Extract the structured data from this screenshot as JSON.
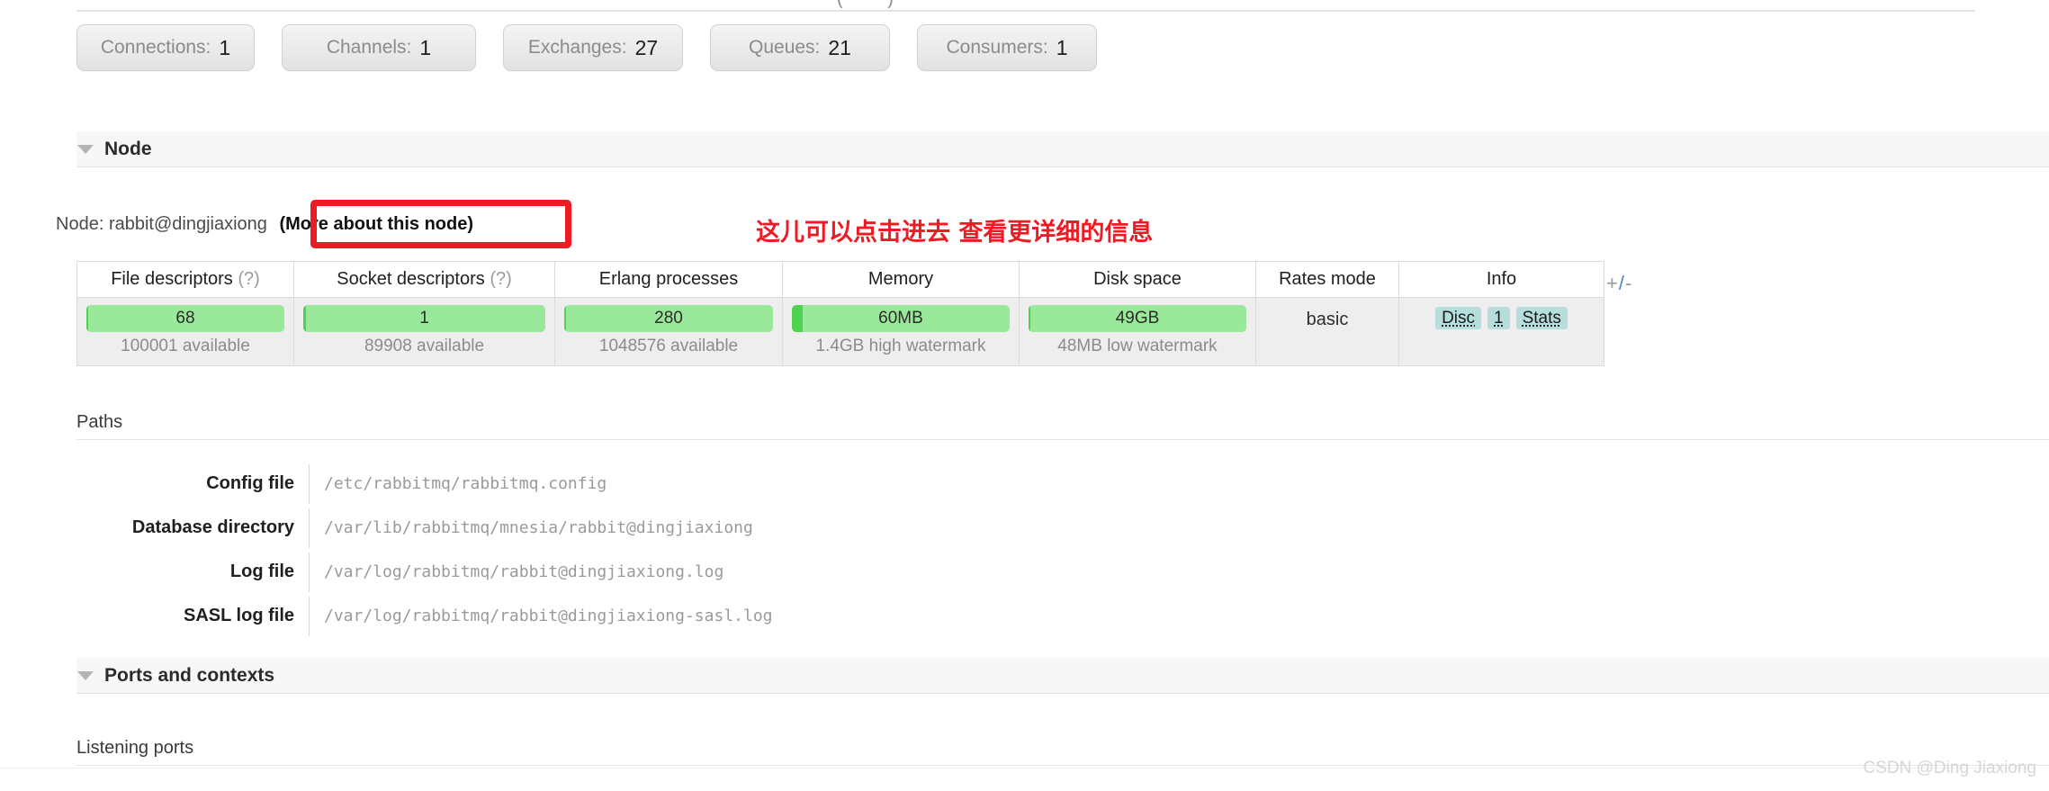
{
  "overview": {
    "stats": [
      {
        "label": "Connections:",
        "value": "1",
        "name": "connections"
      },
      {
        "label": "Channels:",
        "value": "1",
        "name": "channels"
      },
      {
        "label": "Exchanges:",
        "value": "27",
        "name": "exchanges"
      },
      {
        "label": "Queues:",
        "value": "21",
        "name": "queues"
      },
      {
        "label": "Consumers:",
        "value": "1",
        "name": "consumers"
      }
    ]
  },
  "node_section": {
    "title": "Node",
    "node_prefix": "Node:",
    "node_name": "rabbit@dingjiaxiong",
    "more_link": "(More about this node)",
    "plus_minus": {
      "plus": "+",
      "slash": "/",
      "minus": "-"
    }
  },
  "annotation": {
    "text": "这儿可以点击进去 查看更详细的信息",
    "color": "#ed1c24"
  },
  "node_table": {
    "headers": [
      {
        "text": "File descriptors",
        "hint": "(?)"
      },
      {
        "text": "Socket descriptors",
        "hint": "(?)"
      },
      {
        "text": "Erlang processes",
        "hint": ""
      },
      {
        "text": "Memory",
        "hint": ""
      },
      {
        "text": "Disk space",
        "hint": ""
      },
      {
        "text": "Rates mode",
        "hint": ""
      },
      {
        "text": "Info",
        "hint": ""
      }
    ],
    "cells": {
      "file_descriptors": {
        "value": "68",
        "sub": "100001 available",
        "fill_pct": 1
      },
      "socket_descriptors": {
        "value": "1",
        "sub": "89908 available",
        "fill_pct": 1
      },
      "erlang_processes": {
        "value": "280",
        "sub": "1048576 available",
        "fill_pct": 1
      },
      "memory": {
        "value": "60MB",
        "sub": "1.4GB high watermark",
        "fill_pct": 5
      },
      "disk_space": {
        "value": "49GB",
        "sub": "48MB low watermark",
        "fill_pct": 1
      },
      "rates_mode": {
        "value": "basic"
      },
      "info_badges": [
        "Disc",
        "1",
        "Stats"
      ]
    }
  },
  "paths": {
    "heading": "Paths",
    "rows": [
      {
        "label": "Config file",
        "value": "/etc/rabbitmq/rabbitmq.config"
      },
      {
        "label": "Database directory",
        "value": "/var/lib/rabbitmq/mnesia/rabbit@dingjiaxiong"
      },
      {
        "label": "Log file",
        "value": "/var/log/rabbitmq/rabbit@dingjiaxiong.log"
      },
      {
        "label": "SASL log file",
        "value": "/var/log/rabbitmq/rabbit@dingjiaxiong-sasl.log"
      }
    ]
  },
  "ports_section": {
    "title": "Ports and contexts",
    "listening_ports_heading": "Listening ports"
  },
  "watermark": {
    "text": "CSDN @Ding Jiaxiong"
  }
}
